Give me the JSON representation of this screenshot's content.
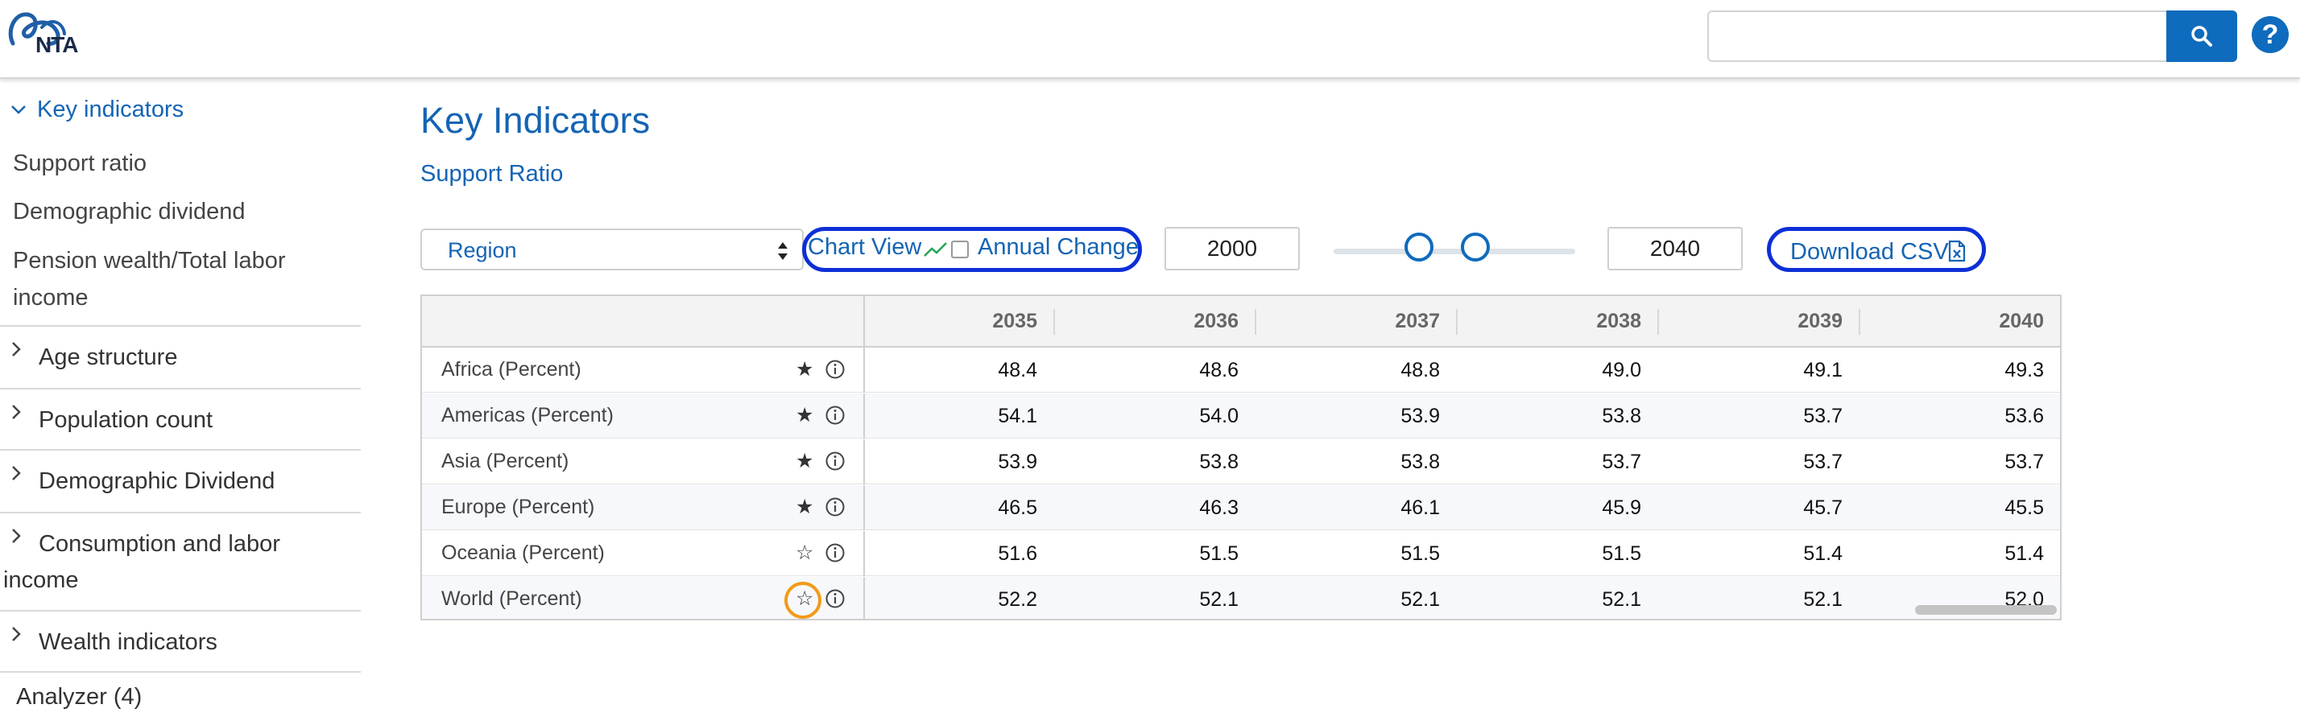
{
  "header": {
    "logo_text": "NTA",
    "search_placeholder": "",
    "help_label": "?"
  },
  "sidebar": {
    "section_title": "Key indicators",
    "sub_items": [
      "Support ratio",
      "Demographic dividend",
      "Pension wealth/Total labor",
      "income"
    ],
    "groups": [
      "Age structure",
      "Population count",
      "Demographic Dividend",
      "Consumption and labor",
      "income",
      "Wealth indicators"
    ],
    "analyzer_label": "Analyzer (4)"
  },
  "main": {
    "title": "Key Indicators",
    "subtitle_link": "Support Ratio",
    "group_select": "Region",
    "chart_view_label": "Chart View",
    "annual_change_label": "Annual Change",
    "annual_change_checked": false,
    "year_from": "2000",
    "year_to": "2040",
    "download_label": "Download CSV"
  },
  "table": {
    "columns": [
      "2035",
      "2036",
      "2037",
      "2038",
      "2039",
      "2040"
    ],
    "rows": [
      {
        "label": "Africa (Percent)",
        "starred": true,
        "values": [
          "48.4",
          "48.6",
          "48.8",
          "49.0",
          "49.1",
          "49.3"
        ]
      },
      {
        "label": "Americas (Percent)",
        "starred": true,
        "values": [
          "54.1",
          "54.0",
          "53.9",
          "53.8",
          "53.7",
          "53.6"
        ]
      },
      {
        "label": "Asia (Percent)",
        "starred": true,
        "values": [
          "53.9",
          "53.8",
          "53.8",
          "53.7",
          "53.7",
          "53.7"
        ]
      },
      {
        "label": "Europe (Percent)",
        "starred": true,
        "values": [
          "46.5",
          "46.3",
          "46.1",
          "45.9",
          "45.7",
          "45.5"
        ]
      },
      {
        "label": "Oceania (Percent)",
        "starred": false,
        "values": [
          "51.6",
          "51.5",
          "51.5",
          "51.5",
          "51.4",
          "51.4"
        ]
      },
      {
        "label": "World (Percent)",
        "starred": false,
        "values": [
          "52.2",
          "52.1",
          "52.1",
          "52.1",
          "52.1",
          "52.0"
        ]
      }
    ]
  },
  "colors": {
    "brand_blue": "#1464b4",
    "button_blue": "#0f6bbd",
    "highlight_outline": "#0d2fd6",
    "focus_ring": "#f29a1a"
  },
  "icons": {
    "search": "search-icon",
    "help": "help-icon",
    "chevron_open": "chevron-down-icon",
    "chevron_closed": "chevron-right-icon",
    "select_arrows": "sort-arrows-icon",
    "trend": "trend-line-icon",
    "csv": "csv-file-icon",
    "star_filled": "star-filled-icon",
    "star_outline": "star-outline-icon",
    "info": "info-icon"
  }
}
